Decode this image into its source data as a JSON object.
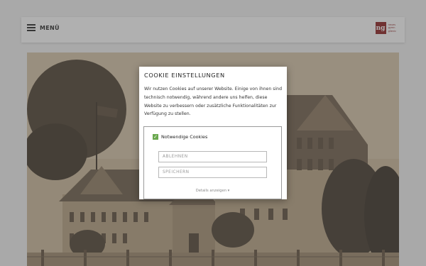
{
  "header": {
    "menu_label": "MENÜ",
    "logo_mark": "ng",
    "logo_lines": [
      "neues",
      "gymn",
      "glienic"
    ]
  },
  "cookie_dialog": {
    "title": "COOKIE EINSTELLUNGEN",
    "text": "Wir nutzen Cookies auf unserer Website. Einige von ihnen sind technisch notwendig, während andere uns helfen, diese Website zu verbessern oder zusätzliche Funktionalitäten zur Verfügung zu stellen.",
    "necessary_label": "Notwendige Cookies",
    "necessary_checked": true,
    "reject_label": "ABLEHNEN",
    "save_label": "SPEICHERN",
    "details_label": "Details anzeigen ▾"
  },
  "colors": {
    "brand": "#8b1a1a",
    "checkbox": "#6aa84f"
  }
}
